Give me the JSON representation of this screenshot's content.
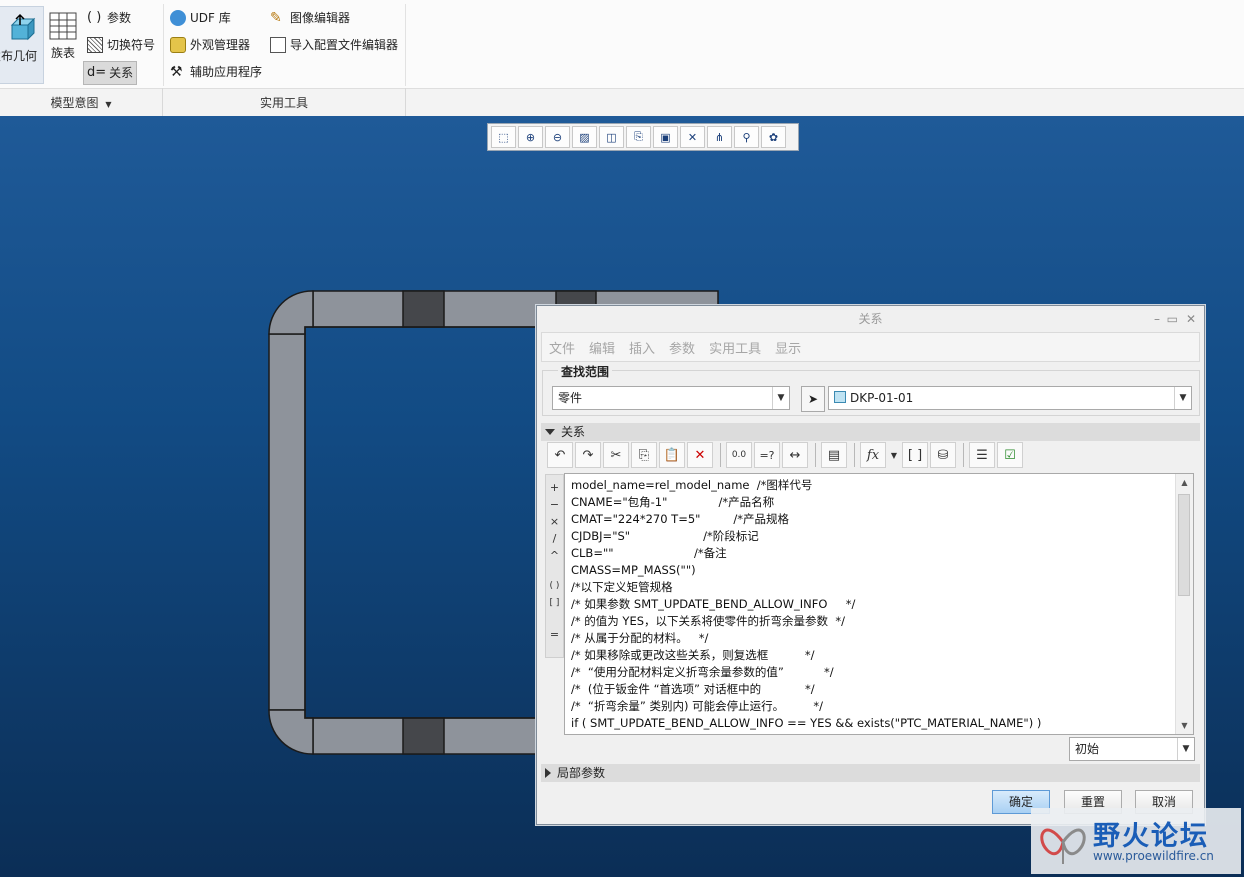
{
  "ribbon": {
    "big_buttons": {
      "publish": "发布几何",
      "family_table": "族表"
    },
    "items": {
      "params": "参数",
      "switch_symbol": "切换符号",
      "relations": "关系",
      "relations_prefix": "d=",
      "udf": "UDF 库",
      "appearance": "外观管理器",
      "aux_app": "辅助应用程序",
      "image_editor": "图像编辑器",
      "import_config": "导入配置文件编辑器"
    },
    "groups": {
      "model_intent": "模型意图",
      "utilities": "实用工具"
    }
  },
  "dialog": {
    "title": "关系",
    "menu": [
      "文件",
      "编辑",
      "插入",
      "参数",
      "实用工具",
      "显示"
    ],
    "scope_label": "查找范围",
    "scope_type": "零件",
    "scope_model": "DKP-01-01",
    "relations_section": "关系",
    "editor_lines": [
      "model_name=rel_model_name  /*图样代号",
      "CNAME=\"包角-1\"              /*产品名称",
      "CMAT=\"224*270 T=5\"         /*产品规格",
      "CJDBJ=\"S\"                    /*阶段标记",
      "CLB=\"\"                      /*备注",
      "CMASS=MP_MASS(\"\")",
      "/*以下定义矩管规格",
      "/* 如果参数 SMT_UPDATE_BEND_ALLOW_INFO     */",
      "/* 的值为 YES，以下关系将使零件的折弯余量参数  */",
      "/* 从属于分配的材料。   */",
      "/* 如果移除或更改这些关系，则复选框          */",
      "/*  “使用分配材料定义折弯余量参数的值”           */",
      "/*  (位于钣金件 “首选项” 对话框中的            */",
      "/*  “折弯余量” 类别内) 可能会停止运行。        */",
      "if ( SMT_UPDATE_BEND_ALLOW_INFO == YES && exists(\"PTC_MATERIAL_NAME\") )"
    ],
    "state_combo": "初始",
    "local_params_section": "局部参数",
    "buttons": {
      "ok": "确定",
      "reset": "重置",
      "cancel": "取消"
    },
    "operators": [
      "+",
      "−",
      "×",
      "/",
      "^",
      "( )",
      "[ ]",
      "="
    ]
  },
  "watermark": {
    "text": "野火论坛",
    "url": "www.proewildfire.cn"
  },
  "colors": {
    "viewport_top": "#1f5a98",
    "viewport_bottom": "#0b2e56",
    "ok_button": "#a9d0f3",
    "part_fill": "#8e939b"
  }
}
